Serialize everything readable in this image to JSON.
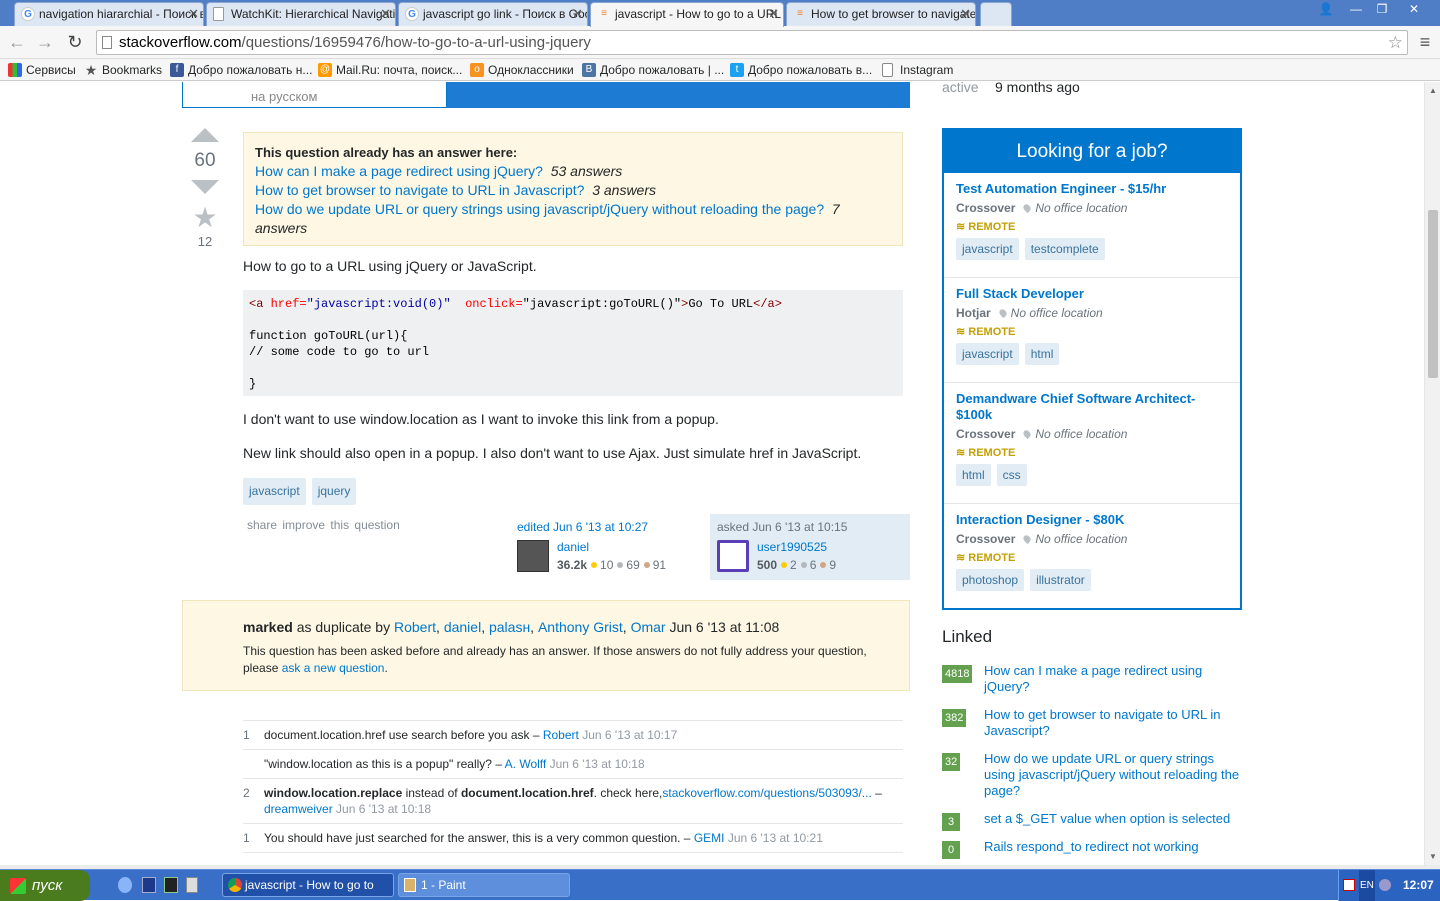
{
  "tabs": [
    {
      "title": "navigation hiararchial - Поиск в Google",
      "fav": "G"
    },
    {
      "title": "WatchKit: Hierarchical Navigation",
      "fav": "doc"
    },
    {
      "title": "javascript go link - Поиск в Google",
      "fav": "G"
    },
    {
      "title": "javascript - How to go to a URL using jQuery",
      "fav": "so"
    },
    {
      "title": "How to get browser to navigate to URL in Javascript",
      "fav": "so"
    }
  ],
  "address": {
    "domain": "stackoverflow.com",
    "path": "/questions/16959476/how-to-go-to-a-url-using-jquery"
  },
  "bookmarks": [
    "Сервисы",
    "Bookmarks",
    "Добро пожаловать н...",
    "Mail.Ru: почта, поиск...",
    "Одноклассники",
    "Добро пожаловать | ...",
    "Добро пожаловать в...",
    "Instagram"
  ],
  "top": {
    "lang": "на русском",
    "active_label": "active",
    "active_value": "9 months ago"
  },
  "question": {
    "votes": "60",
    "favorites": "12",
    "dup_heading": "This question already has an answer here:",
    "dups": [
      {
        "title": "How can I make a page redirect using jQuery?",
        "count": "53 answers"
      },
      {
        "title": "How to get browser to navigate to URL in Javascript?",
        "count": "3 answers"
      },
      {
        "title": "How do we update URL or query strings using javascript/jQuery without reloading the page?",
        "count": "7 answers"
      }
    ],
    "intro": "How to go to a URL using jQuery or JavaScript.",
    "code": {
      "a_open": "<a ",
      "href_attr": "href=",
      "href_val": "\"javascript:void(0)\"",
      "onclick_attr": "onclick=",
      "onclick_val": "\"javascript:goToURL()\"",
      "close": ">",
      "text": "Go To URL",
      "a_close": "</a>",
      "l2": "function goToURL(url){",
      "l3": "// some code to go to url",
      "l4": "}"
    },
    "p1": "I don't want to use window.location as I want to invoke this link from a popup.",
    "p2": "New link should also open in a popup. I also don't want to use Ajax. Just simulate href in JavaScript.",
    "tags": [
      "javascript",
      "jquery"
    ],
    "menu": {
      "share": "share",
      "improve": "improve this question"
    },
    "editor": {
      "when": "edited Jun 6 '13 at 10:27",
      "name": "daniel",
      "rep": "36.2k",
      "gold": "10",
      "silver": "69",
      "bronze": "91"
    },
    "asker": {
      "when": "asked Jun 6 '13 at 10:15",
      "name": "user1990525",
      "rep": "500",
      "gold": "2",
      "silver": "6",
      "bronze": "9"
    }
  },
  "marked": {
    "word": "marked",
    "mid": "as duplicate by",
    "users": [
      "Robert",
      "daniel",
      "palaѕн",
      "Anthony Grist",
      "Omar"
    ],
    "date": "Jun 6 '13 at 11:08",
    "text": "This question has been asked before and already has an answer. If those answers do not fully address your question, please",
    "link": "ask a new question",
    "end": "."
  },
  "comments": [
    {
      "score": "1",
      "text": "document.location.href use search before you ask –",
      "user": "Robert",
      "date": "Jun 6 '13 at 10:17"
    },
    {
      "score": "",
      "text": "\"window.location as this is a popup\" really? –",
      "user": "A. Wolff",
      "date": "Jun 6 '13 at 10:18"
    },
    {
      "score": "2",
      "b1": "window.location.replace",
      "t1": " instead of ",
      "b2": "document.location.href",
      "t2": ". check here,",
      "link": "stackoverflow.com/questions/503093/...",
      "sep": " –",
      "user": "dreamweiver",
      "date": "Jun 6 '13 at 10:18"
    },
    {
      "score": "1",
      "text": "You should have just searched for the answer, this is a very common question. –",
      "user": "GEMI",
      "date": "Jun 6 '13 at 10:21"
    }
  ],
  "jobs": {
    "heading": "Looking for a job?",
    "remote": "REMOTE",
    "loc": "No office location",
    "items": [
      {
        "title": "Test Automation Engineer - $15/hr",
        "company": "Crossover",
        "tags": [
          "javascript",
          "testcomplete"
        ]
      },
      {
        "title": "Full Stack Developer",
        "company": "Hotjar",
        "tags": [
          "javascript",
          "html"
        ]
      },
      {
        "title": "Demandware Chief Software Architect- $100k",
        "company": "Crossover",
        "tags": [
          "html",
          "css"
        ]
      },
      {
        "title": "Interaction Designer - $80K",
        "company": "Crossover",
        "tags": [
          "photoshop",
          "illustrator"
        ]
      }
    ]
  },
  "linked": {
    "heading": "Linked",
    "items": [
      {
        "score": "4818",
        "title": "How can I make a page redirect using jQuery?"
      },
      {
        "score": "382",
        "title": "How to get browser to navigate to URL in Javascript?"
      },
      {
        "score": "32",
        "title": "How do we update URL or query strings using javascript/jQuery without reloading the page?"
      },
      {
        "score": "3",
        "title": "set a $_GET value when option is selected"
      },
      {
        "score": "0",
        "title": "Rails respond_to redirect not working"
      }
    ]
  },
  "taskbar": {
    "start": "пуск",
    "tasks": [
      "javascript - How to go to",
      "1 - Paint"
    ],
    "lang": "EN",
    "clock": "12:07"
  },
  "colors": {
    "accent": "#0077cc",
    "dup_bg": "#fdf7e3",
    "tag_bg": "#e1ecf4",
    "gold": "#ffcc01",
    "silver": "#b4b8bc",
    "bronze": "#d1a684",
    "remote": "#c4a000"
  }
}
